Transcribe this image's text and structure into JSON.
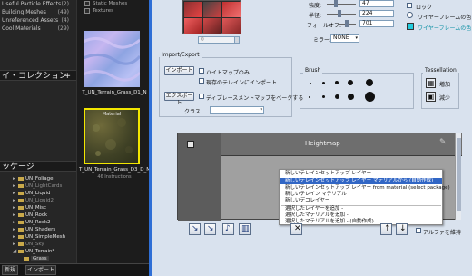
{
  "left_panel": {
    "packages": [
      {
        "label": "Useful Particle Effects",
        "count": "(2)"
      },
      {
        "label": "Building Meshes",
        "count": "(49)"
      },
      {
        "label": "Unreferenced Assets",
        "count": "(4)"
      },
      {
        "label": "Cool Materials",
        "count": "(29)"
      }
    ],
    "collections_header": "イ・コレクション",
    "packages_header": "ッケージ",
    "tree": [
      {
        "label": "UN_Foliage",
        "dim": true
      },
      {
        "label": "UN_LightCards",
        "dim": true
      },
      {
        "label": "UN_Liquid",
        "dim": false
      },
      {
        "label": "UN_Liquid2",
        "dim": true
      },
      {
        "label": "UN_Misc",
        "dim": false
      },
      {
        "label": "UN_Rock",
        "dim": false
      },
      {
        "label": "UN_Rock2",
        "dim": false
      },
      {
        "label": "UN_Shaders",
        "dim": false
      },
      {
        "label": "UN_SimpleMesh",
        "dim": false
      },
      {
        "label": "UN_Sky",
        "dim": true
      },
      {
        "label": "UN_Terrain*",
        "dim": false
      },
      {
        "label": "Grass",
        "dim": false
      }
    ]
  },
  "mid_panel": {
    "filters": [
      "Static Meshes",
      "Textures"
    ],
    "thumbs": [
      {
        "label": "T_UN_Terrain_Grass_D1_N",
        "sub": ""
      },
      {
        "label": "T_UN_Terrain_Grass_D3_D_M",
        "sub": "46 Instructions",
        "tag": "Material"
      }
    ]
  },
  "bottom_bar": {
    "btn1": "新規",
    "btn2": "インポート"
  },
  "dialog": {
    "icons_area": {
      "field_value": "0"
    },
    "settings": {
      "strength_label": "強度:",
      "strength_value": "47",
      "radius_label": "半径:",
      "radius_value": "224",
      "falloff_label": "フォールオフ:",
      "falloff_value": "701",
      "mirror_label": "ミラー:",
      "mirror_value": "NONE"
    },
    "options": {
      "lock": "ロック",
      "wireframe_color_label": "ワイヤーフレームの色",
      "wireframe_color_label2": "ワイヤーフレームの色",
      "wireframe_color": "#00c8d8",
      "wireframe_color_box": "#22ccdd"
    },
    "import_export": {
      "title": "Import/Export",
      "import_btn": "インポート",
      "heightmap_only": "ハイトマップのみ",
      "import_existing": "現存のテレインにインポート",
      "export_btn": "エクスポート",
      "bake_displacement": "ディプレースメントマップをベークする",
      "class_label": "クラス"
    },
    "brush": {
      "title": "Brush"
    },
    "tessellation": {
      "title": "Tessellation",
      "increase": "増加",
      "decrease": "減少"
    },
    "table": {
      "heightmap_header": "Heightmap"
    },
    "context_menu": {
      "items": [
        "新しいテレインセットアップ レイヤー",
        "新しいテレインセットアップ レイヤー マテリアルから (自動作成)",
        "新しいテレインセットアップ レイヤー from material (select package)",
        "新しいテレイン マテリアル",
        "新しいデコレイヤー",
        "選択したレイヤーを追加 -",
        "選択したマテリアルを追加 -",
        "選択したマテリアルを追加 - (自動作成)"
      ],
      "selected_index": 1
    },
    "bottom": {
      "alpha_label": "アルファを維持"
    }
  }
}
